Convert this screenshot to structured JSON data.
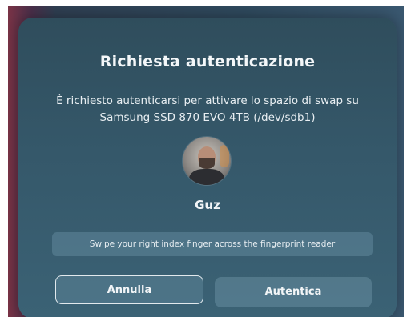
{
  "dialog": {
    "title": "Richiesta autenticazione",
    "message": "È richiesto autenticarsi per attivare lo spazio di swap su Samsung SSD 870 EVO 4TB (/dev/sdb1)",
    "user": {
      "name": "Guz"
    },
    "fingerprint_prompt": "Swipe your right index finger across the fingerprint reader",
    "buttons": {
      "cancel_label": "Annulla",
      "authenticate_label": "Autentica"
    }
  }
}
